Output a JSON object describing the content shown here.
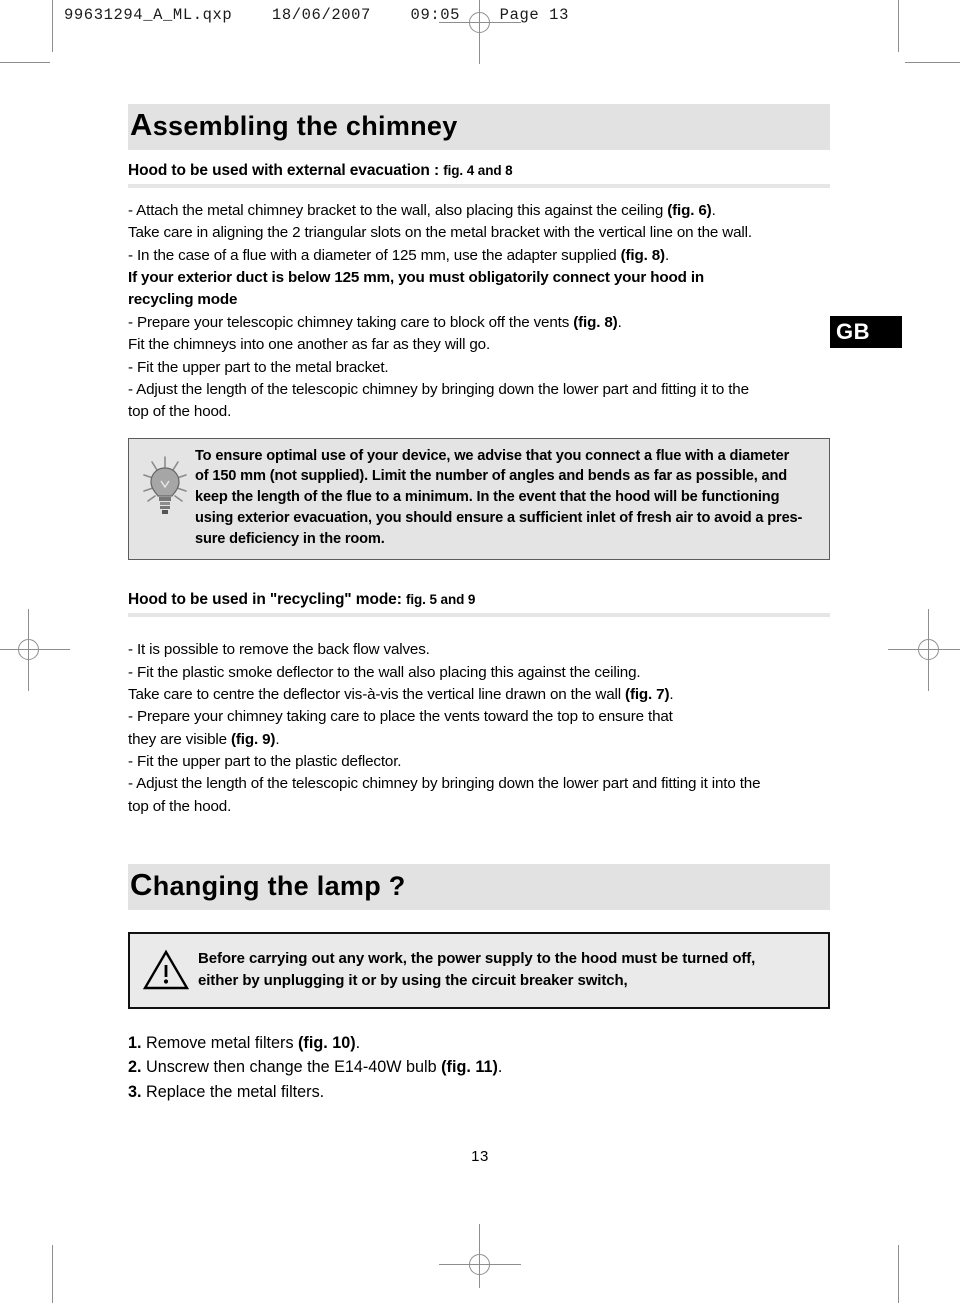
{
  "printer_slug": "99631294_A_ML.qxp    18/06/2007    09:05    Page 13",
  "language_tab": "GB",
  "folio": "13",
  "section1": {
    "title_cap": "A",
    "title_rest": "ssembling the chimney",
    "subheading_main": "Hood to be used with external evacuation : ",
    "subheading_fig": "fig. 4 and 8",
    "lines": [
      {
        "text": "- Attach the metal chimney bracket to the wall, also placing this against the ceiling ",
        "bold_tail": "(fig. 6)",
        "tail": "."
      },
      {
        "text": "Take care in aligning the 2 triangular slots on the metal bracket with the vertical line on the wall.",
        "bold_tail": "",
        "tail": ""
      },
      {
        "text": "- In the case of a flue with a diameter of 125 mm, use the adapter supplied  ",
        "bold_tail": "(fig. 8)",
        "tail": "."
      }
    ],
    "bold_block": "If your exterior duct is below 125 mm, you must obligatorily connect your hood in",
    "bold_block_last": "recycling mode",
    "lines2": [
      {
        "text": "- Prepare your telescopic chimney taking care to block off the vents ",
        "bold_tail": "(fig. 8)",
        "tail": "."
      },
      {
        "text": "Fit the chimneys into one another as far as they will go.",
        "bold_tail": "",
        "tail": ""
      },
      {
        "text": "- Fit the upper part to the metal bracket.",
        "bold_tail": "",
        "tail": ""
      },
      {
        "text": "- Adjust the length of the telescopic chimney by bringing down the lower part and fitting it to the",
        "bold_tail": "",
        "tail": ""
      },
      {
        "text": "top of the hood.",
        "bold_tail": "",
        "tail": ""
      }
    ]
  },
  "tip_box": {
    "icon": "lightbulb-icon",
    "lines": [
      "To ensure optimal use of your device, we advise that you connect a flue with a diameter",
      "of 150 mm (not supplied).  Limit the number of angles and bends as far as possible, and",
      "keep  the length of the flue to a minimum.  In the event that the hood will be functioning",
      "using exterior evacuation, you should ensure a sufficient inlet of fresh air to avoid a pres-",
      "sure deficiency in the room."
    ]
  },
  "section2": {
    "subheading_main": "Hood to be used in \"recycling\" mode: ",
    "subheading_fig": "fig. 5 and 9",
    "lines": [
      {
        "text": "- It is possible to remove the back flow valves.",
        "bold_tail": "",
        "tail": ""
      },
      {
        "text": "- Fit the plastic smoke deflector to the wall also placing this against the ceiling.",
        "bold_tail": "",
        "tail": ""
      },
      {
        "text": "Take care to centre the deflector vis-à-vis the vertical line drawn on the wall ",
        "bold_tail": "(fig. 7)",
        "tail": "."
      },
      {
        "text": "- Prepare your chimney taking care to place the vents toward the top to ensure that",
        "bold_tail": "",
        "tail": ""
      },
      {
        "text": "they are visible ",
        "bold_tail": "(fig. 9)",
        "tail": "."
      },
      {
        "text": "- Fit the upper part to the plastic deflector.",
        "bold_tail": "",
        "tail": ""
      },
      {
        "text": "- Adjust the length of the telescopic chimney by bringing down the lower part and fitting it into the",
        "bold_tail": "",
        "tail": ""
      },
      {
        "text": "top of the hood.",
        "bold_tail": "",
        "tail": ""
      }
    ]
  },
  "section3": {
    "title_cap": "C",
    "title_rest": "hanging the lamp ?",
    "warning": {
      "icon": "warning-triangle-icon",
      "lines": [
        "Before carrying out any work, the power supply to the hood must be turned off,",
        "either by unplugging it or by  using the circuit breaker switch,"
      ]
    },
    "steps": [
      {
        "num": "1.",
        "text": " Remove metal filters ",
        "fig": "(fig. 10)",
        "tail": "."
      },
      {
        "num": "2.",
        "text": " Unscrew then change the E14-40W bulb ",
        "fig": "(fig. 11)",
        "tail": "."
      },
      {
        "num": "3.",
        "text": " Replace the metal filters.",
        "fig": "",
        "tail": ""
      }
    ]
  },
  "colors": {
    "title_bar_bg": "#e2e2e2",
    "rule": "#e6e6e6",
    "tip_bg": "#e4e4e4",
    "tip_border": "#5c5c5c",
    "warn_bg": "#eaeaea",
    "warn_border": "#111111",
    "tab_bg": "#000000",
    "tab_fg": "#ffffff",
    "mark": "#8e8e8e"
  }
}
